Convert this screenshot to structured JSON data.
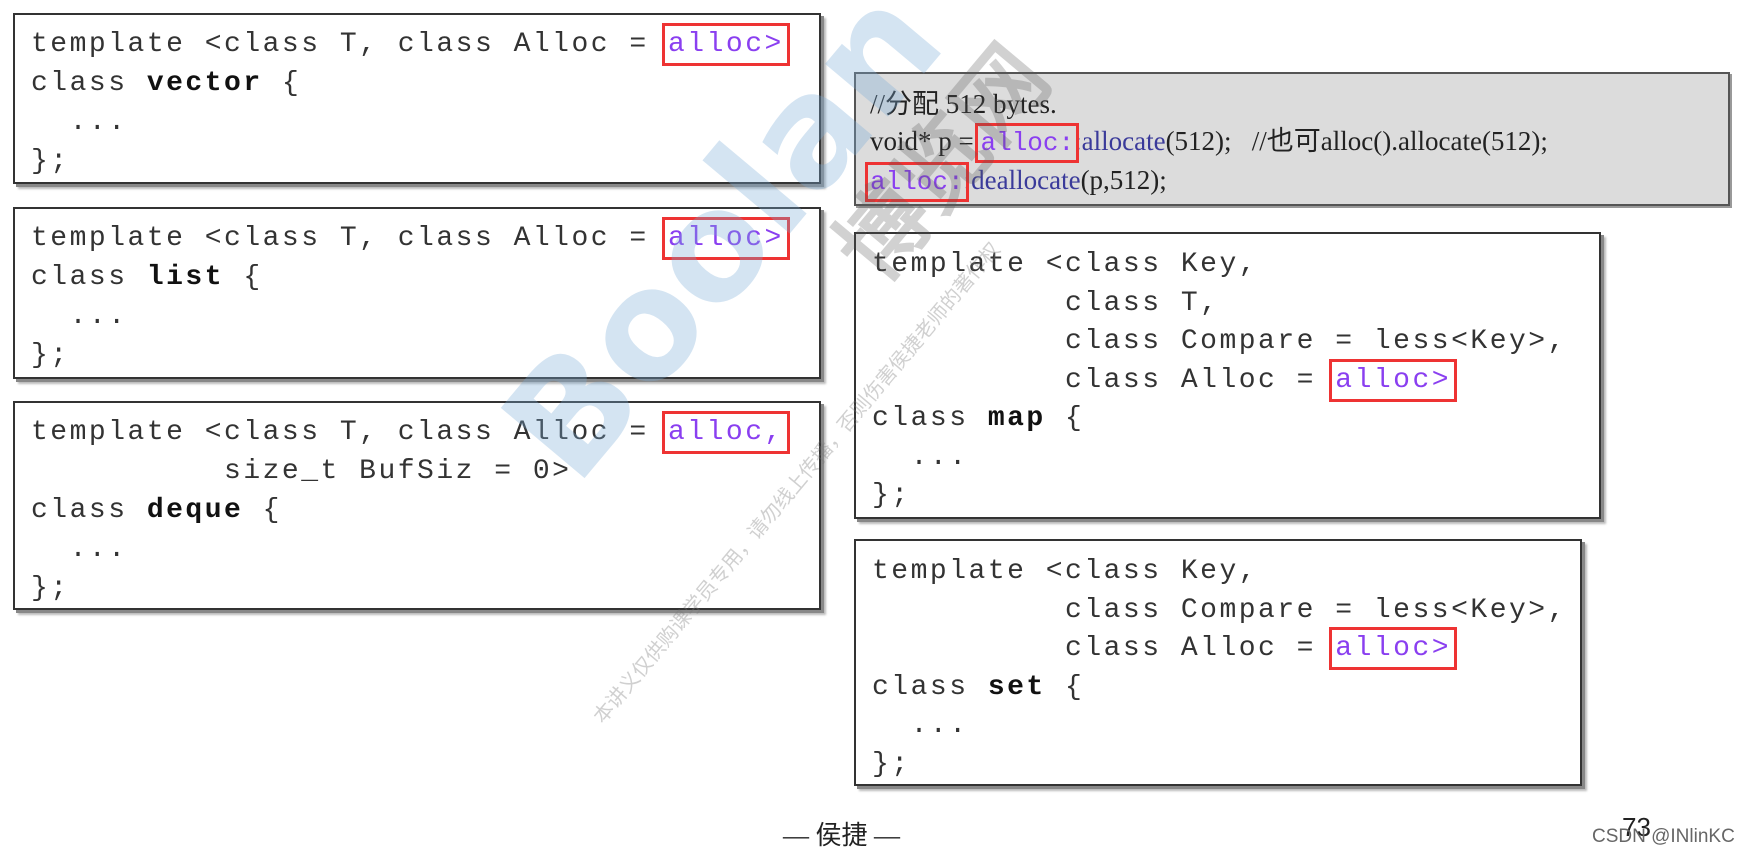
{
  "vector_box": {
    "l1_pre": "template <class T, class Alloc = ",
    "l1_hl": "alloc>",
    "l1_post": "",
    "l2_pre": "class ",
    "l2_kw": "vector",
    "l2_post": " {",
    "l3": "  ...",
    "l4": "};"
  },
  "list_box": {
    "l1_pre": "template <class T, class Alloc = ",
    "l1_hl": "alloc>",
    "l1_post": "",
    "l2_pre": "class ",
    "l2_kw": "list",
    "l2_post": " {",
    "l3": "  ...",
    "l4": "};"
  },
  "deque_box": {
    "l1_pre": "template <class T, class Alloc = ",
    "l1_hl": "alloc,",
    "l1_post": "",
    "l2": "          size_t BufSiz = 0>",
    "l3_pre": "class ",
    "l3_kw": "deque",
    "l3_post": " {",
    "l4": "  ...",
    "l5": "};"
  },
  "alloc_box": {
    "l1": "//分配 512 bytes.",
    "l2_pre": "void* p = ",
    "l2_hl": "alloc:",
    "l2_fn": ":allocate",
    "l2_post": "(512);   //也可alloc().allocate(512);",
    "l3_hl": "alloc:",
    "l3_fn": ":deallocate",
    "l3_post": "(p,512);"
  },
  "map_box": {
    "l1": "template <class Key,",
    "l2": "          class T,",
    "l3": "          class Compare = less<Key>,",
    "l4_pre": "          class Alloc = ",
    "l4_hl": "alloc>",
    "l5_pre": "class ",
    "l5_kw": "map",
    "l5_post": " {",
    "l6": "  ...",
    "l7": "};"
  },
  "set_box": {
    "l1": "template <class Key,",
    "l2": "          class Compare = less<Key>,",
    "l3_pre": "          class Alloc = ",
    "l3_hl": "alloc>",
    "l4_pre": "class ",
    "l4_kw": "set",
    "l4_post": " {",
    "l5": "  ...",
    "l6": "};"
  },
  "watermark": {
    "brand": "Boolan",
    "cn": "博览网",
    "notice": "本讲义仅供购课学员专用，请勿线上传播，否则伤害侯捷老师的著作权"
  },
  "footer": {
    "author": "— 侯捷 —",
    "page_number": "73",
    "credit": "CSDN @INlinKC"
  },
  "colors": {
    "highlight_text": "#8a3ff0",
    "highlight_box": "#ee3333",
    "alloc_box_bg": "#dcdcdc"
  }
}
